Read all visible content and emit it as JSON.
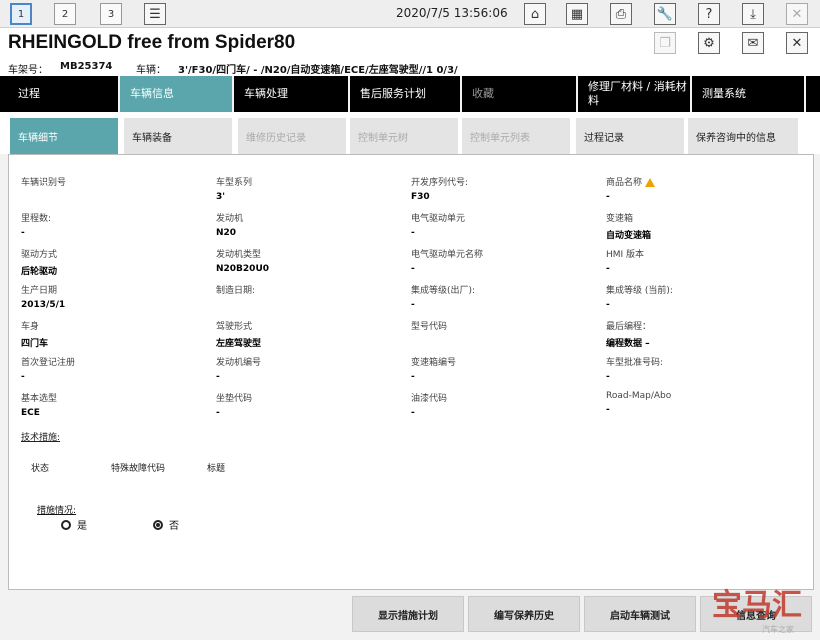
{
  "toolbar": {
    "tabs": [
      "1",
      "2",
      "3"
    ],
    "datetime": "2020/7/5 13:56:06",
    "icons": [
      "list-icon",
      "home-icon",
      "keypad-icon",
      "printer-icon",
      "wrench-icon",
      "help-icon",
      "download-icon",
      "close-icon"
    ]
  },
  "app": {
    "title": "RHEINGOLD free from Spider80"
  },
  "vehicle_line": {
    "chassis_label": "车架号：",
    "chassis_value": "MB25374",
    "vehicle_label": "车辆：",
    "vehicle_value": "3'/F30/四门车/ - /N20/自动变速箱/ECE/左座驾驶型//1 0/3/"
  },
  "mainnav": [
    "过程",
    "车辆信息",
    "车辆处理",
    "售后服务计划",
    "收藏",
    "修理厂材料 / 消耗材料",
    "测量系统"
  ],
  "subtabs": [
    "车辆细节",
    "车辆装备",
    "维修历史记录",
    "控制单元树",
    "控制单元列表",
    "过程记录",
    "保养咨询中的信息"
  ],
  "fields": [
    {
      "label": "车辆识别号",
      "value": ""
    },
    {
      "label": "车型系列",
      "value": "3'"
    },
    {
      "label": "开发序列代号:",
      "value": "F30"
    },
    {
      "label": "商品名称",
      "value": "-"
    },
    {
      "label": "里程数:",
      "value": "-"
    },
    {
      "label": "发动机",
      "value": "N20"
    },
    {
      "label": "电气驱动单元",
      "value": "-"
    },
    {
      "label": "变速箱",
      "value": "自动变速箱"
    },
    {
      "label": "驱动方式",
      "value": "后轮驱动"
    },
    {
      "label": "发动机类型",
      "value": "N20B20U0"
    },
    {
      "label": "电气驱动单元名称",
      "value": "-"
    },
    {
      "label": "HMI 版本",
      "value": "-"
    },
    {
      "label": "生产日期",
      "value": "2013/5/1"
    },
    {
      "label": "制造日期:",
      "value": ""
    },
    {
      "label": "集成等级(出厂):",
      "value": "-"
    },
    {
      "label": "集成等级 (当前):",
      "value": "-"
    },
    {
      "label": "车身",
      "value": "四门车"
    },
    {
      "label": "驾驶形式",
      "value": "左座驾驶型"
    },
    {
      "label": "型号代码",
      "value": ""
    },
    {
      "label": "最后编程：",
      "value": "编程数据 –"
    },
    {
      "label": "首次登记注册",
      "value": "-"
    },
    {
      "label": "发动机编号",
      "value": "-"
    },
    {
      "label": "变速箱编号",
      "value": "-"
    },
    {
      "label": "车型批准号码:",
      "value": "-"
    },
    {
      "label": "基本选型",
      "value": "ECE"
    },
    {
      "label": "坐垫代码",
      "value": "-"
    },
    {
      "label": "油漆代码",
      "value": "-"
    },
    {
      "label": "Road-Map/Abo",
      "value": "-"
    }
  ],
  "tech": {
    "header": "技术措施:",
    "columns": [
      "状态",
      "特殊故障代码",
      "标题"
    ]
  },
  "measures": {
    "label": "措施情况:",
    "yes": "是",
    "no": "否",
    "selected": "否"
  },
  "bottom_buttons": [
    "显示措施计划",
    "编写保养历史",
    "启动车辆测试",
    "信息查询"
  ],
  "watermark": {
    "text": "宝马汇",
    "small": "汽车之家"
  }
}
